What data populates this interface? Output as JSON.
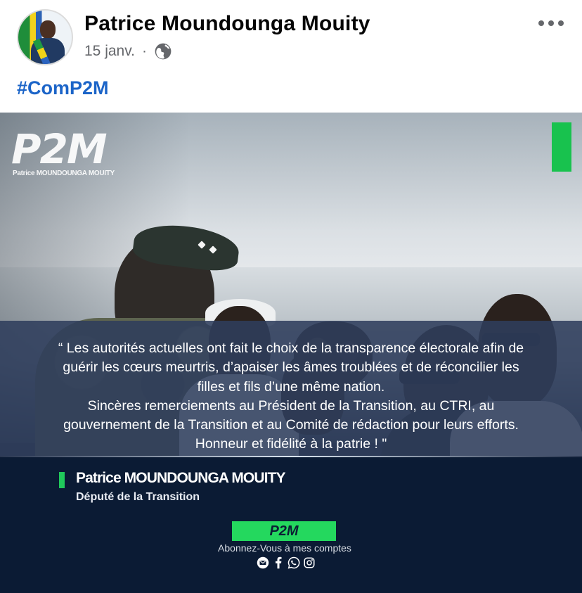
{
  "post": {
    "author": "Patrice Moundounga Mouity",
    "date": "15 janv.",
    "separator": "·",
    "hashtag": "#ComP2M"
  },
  "icons": {
    "privacy": "globe-icon",
    "more": "more-options-icon",
    "email": "email-icon",
    "facebook": "facebook-icon",
    "whatsapp": "whatsapp-icon",
    "instagram": "instagram-icon"
  },
  "image": {
    "logo": "P2M",
    "logo_subtitle": "Patrice MOUNDOUNGA MOUITY",
    "quote": "“ Les autorités actuelles ont fait le choix de la transparence électorale afin de\nguérir les cœurs meurtris, d’apaiser les âmes troublées et de réconcilier les\nfilles et fils d’une même nation.\nSincères remerciements au Président de la Transition, au CTRI, au\ngouvernement de la Transition et au Comité de rédaction pour leurs efforts.\nHonneur et fidélité à la patrie ! \"",
    "signature_name": "Patrice MOUNDOUNGA MOUITY",
    "signature_role": "Député de la Transition",
    "badge": "P2M",
    "subscribe": "Abonnez-Vous à mes comptes"
  },
  "colors": {
    "hashtag": "#1b64c8",
    "brand_green": "#24d85e",
    "footer_navy": "#0b1b34",
    "quote_overlay": "#2f3d5c"
  }
}
